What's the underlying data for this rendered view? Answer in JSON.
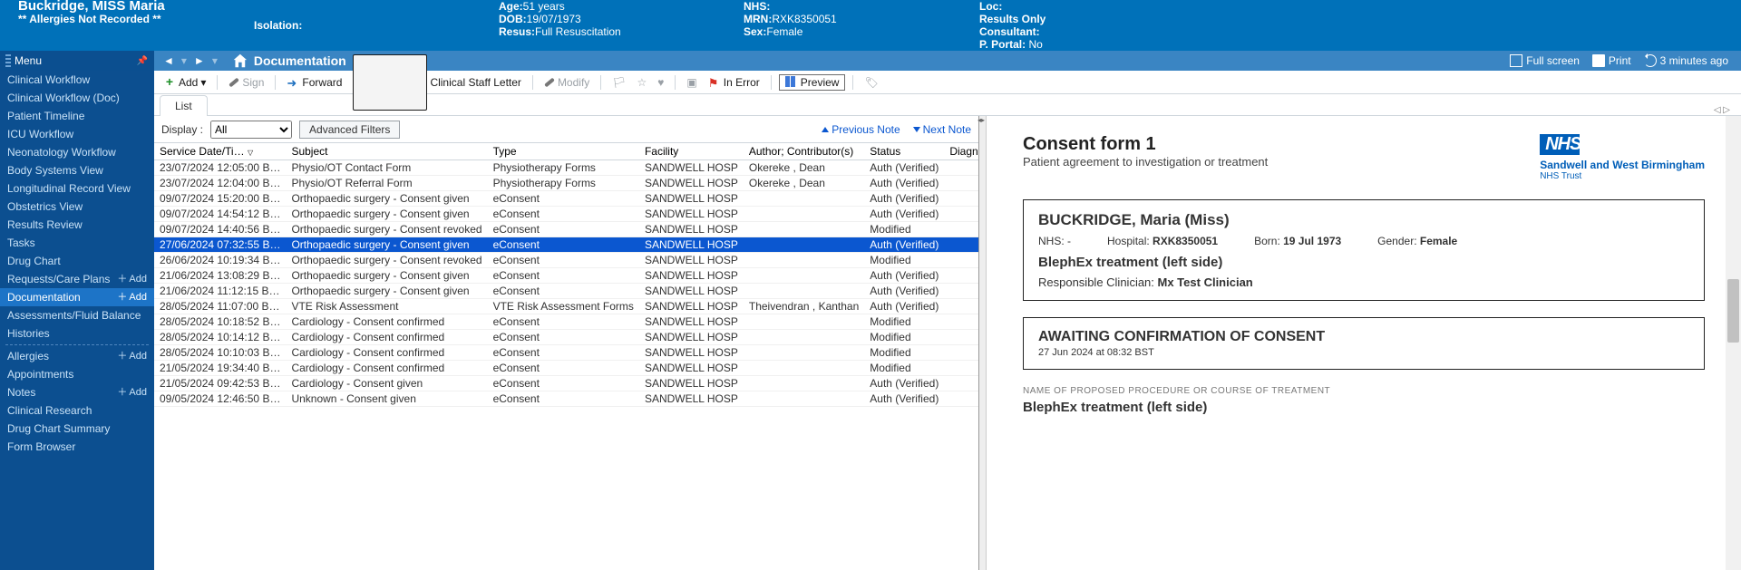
{
  "banner": {
    "patient_name": "Buckridge, MISS Maria",
    "allergies": "** Allergies Not Recorded **",
    "isolation_label": "Isolation:",
    "age_label": "Age:",
    "age": "51 years",
    "dob_label": "DOB:",
    "dob": "19/07/1973",
    "resus_label": "Resus:",
    "resus": "Full Resuscitation",
    "nhs_label": "NHS:",
    "mrn_label": "MRN:",
    "mrn": "RXK8350051",
    "sex_label": "Sex:",
    "sex": "Female",
    "loc_label": "Loc:",
    "results_only": "Results Only",
    "consultant_label": "Consultant:",
    "portal_label": "P. Portal:",
    "portal": " No"
  },
  "subnav": {
    "menu": "Menu",
    "crumb": "Documentation",
    "fullscreen": "Full screen",
    "print": "Print",
    "refresh": "3 minutes ago"
  },
  "sidebar": {
    "add": "Add",
    "items": [
      {
        "label": "Clinical Workflow"
      },
      {
        "label": "Clinical Workflow (Doc)"
      },
      {
        "label": "Patient Timeline"
      },
      {
        "label": "ICU Workflow"
      },
      {
        "label": "Neonatology Workflow"
      },
      {
        "label": "Body Systems View"
      },
      {
        "label": "Longitudinal Record View"
      },
      {
        "label": "Obstetrics View"
      },
      {
        "label": "Results Review"
      },
      {
        "label": "Tasks"
      },
      {
        "label": "Drug Chart"
      },
      {
        "label": "Requests/Care Plans",
        "add": true
      },
      {
        "label": "Documentation",
        "add": true,
        "active": true
      },
      {
        "label": "Assessments/Fluid Balance"
      },
      {
        "label": "Histories"
      },
      {
        "sep": true
      },
      {
        "label": "Allergies",
        "add": true
      },
      {
        "label": "Appointments"
      },
      {
        "label": "Notes",
        "add": true
      },
      {
        "label": "Clinical Research"
      },
      {
        "label": "Drug Chart Summary"
      },
      {
        "label": "Form Browser"
      }
    ]
  },
  "toolbar": {
    "add": "Add",
    "sign": "Sign",
    "forward": "Forward",
    "csl": "Clinical Staff Letter",
    "modify": "Modify",
    "inerror": "In Error",
    "preview": "Preview"
  },
  "tabs": {
    "list": "List"
  },
  "filter": {
    "display": "Display :",
    "all": "All",
    "advanced": "Advanced Filters",
    "prev": "Previous Note",
    "next": "Next Note"
  },
  "columns": {
    "date": "Service Date/Ti…",
    "subject": "Subject",
    "type": "Type",
    "facility": "Facility",
    "author": "Author; Contributor(s)",
    "status": "Status",
    "diag": "Diagnos"
  },
  "rows": [
    {
      "d": "23/07/2024 12:05:00 B…",
      "s": "Physio/OT Contact Form",
      "t": "Physiotherapy Forms",
      "f": "SANDWELL HOSP",
      "a": "Okereke , Dean",
      "st": "Auth (Verified)"
    },
    {
      "d": "23/07/2024 12:04:00 B…",
      "s": "Physio/OT Referral Form",
      "t": "Physiotherapy Forms",
      "f": "SANDWELL HOSP",
      "a": "Okereke , Dean",
      "st": "Auth (Verified)"
    },
    {
      "d": "09/07/2024 15:20:00 B…",
      "s": "Orthopaedic surgery - Consent given",
      "t": "eConsent",
      "f": "SANDWELL HOSP",
      "a": "",
      "st": "Auth (Verified)"
    },
    {
      "d": "09/07/2024 14:54:12 B…",
      "s": "Orthopaedic surgery - Consent given",
      "t": "eConsent",
      "f": "SANDWELL HOSP",
      "a": "",
      "st": "Auth (Verified)"
    },
    {
      "d": "09/07/2024 14:40:56 B…",
      "s": "Orthopaedic surgery - Consent revoked",
      "t": "eConsent",
      "f": "SANDWELL HOSP",
      "a": "",
      "st": "Modified"
    },
    {
      "d": "27/06/2024 07:32:55 B…",
      "s": "Orthopaedic surgery - Consent given",
      "t": "eConsent",
      "f": "SANDWELL HOSP",
      "a": "",
      "st": "Auth (Verified)",
      "sel": true
    },
    {
      "d": "26/06/2024 10:19:34 B…",
      "s": "Orthopaedic surgery - Consent revoked",
      "t": "eConsent",
      "f": "SANDWELL HOSP",
      "a": "",
      "st": "Modified"
    },
    {
      "d": "21/06/2024 13:08:29 B…",
      "s": "Orthopaedic surgery - Consent given",
      "t": "eConsent",
      "f": "SANDWELL HOSP",
      "a": "",
      "st": "Auth (Verified)"
    },
    {
      "d": "21/06/2024 11:12:15 B…",
      "s": "Orthopaedic surgery - Consent given",
      "t": "eConsent",
      "f": "SANDWELL HOSP",
      "a": "",
      "st": "Auth (Verified)"
    },
    {
      "d": "28/05/2024 11:07:00 B…",
      "s": "VTE Risk Assessment",
      "t": "VTE Risk Assessment Forms",
      "f": "SANDWELL HOSP",
      "a": "Theivendran , Kanthan",
      "st": "Auth (Verified)"
    },
    {
      "d": "28/05/2024 10:18:52 B…",
      "s": "Cardiology - Consent confirmed",
      "t": "eConsent",
      "f": "SANDWELL HOSP",
      "a": "",
      "st": "Modified"
    },
    {
      "d": "28/05/2024 10:14:12 B…",
      "s": "Cardiology - Consent confirmed",
      "t": "eConsent",
      "f": "SANDWELL HOSP",
      "a": "",
      "st": "Modified"
    },
    {
      "d": "28/05/2024 10:10:03 B…",
      "s": "Cardiology - Consent confirmed",
      "t": "eConsent",
      "f": "SANDWELL HOSP",
      "a": "",
      "st": "Modified"
    },
    {
      "d": "21/05/2024 19:34:40 B…",
      "s": "Cardiology - Consent confirmed",
      "t": "eConsent",
      "f": "SANDWELL HOSP",
      "a": "",
      "st": "Modified"
    },
    {
      "d": "21/05/2024 09:42:53 B…",
      "s": "Cardiology - Consent given",
      "t": "eConsent",
      "f": "SANDWELL HOSP",
      "a": "",
      "st": "Auth (Verified)"
    },
    {
      "d": "09/05/2024 12:46:50 B…",
      "s": "Unknown - Consent given",
      "t": "eConsent",
      "f": "SANDWELL HOSP",
      "a": "",
      "st": "Auth (Verified)"
    }
  ],
  "preview": {
    "title": "Consent form 1",
    "subtitle": "Patient agreement to investigation or treatment",
    "nhs": "NHS",
    "trust": "Sandwell and West Birmingham",
    "trust_sub": "NHS Trust",
    "patient": "BUCKRIDGE, Maria (Miss)",
    "nhs_lbl": "NHS:",
    "nhs_val": " -",
    "hosp_lbl": "Hospital:",
    "hosp_val": " RXK8350051",
    "born_lbl": "Born:",
    "born_val": " 19 Jul 1973",
    "gender_lbl": "Gender:",
    "gender_val": " Female",
    "procedure": "BlephEx treatment (left side)",
    "clin_lbl": "Responsible Clinician: ",
    "clin_val": "Mx Test Clinician",
    "await_h": "AWAITING CONFIRMATION OF CONSENT",
    "await_t": "27 Jun 2024 at 08:32 BST",
    "sect_label": "NAME OF PROPOSED PROCEDURE OR COURSE OF TREATMENT",
    "sect_val": "BlephEx treatment (left side)"
  }
}
